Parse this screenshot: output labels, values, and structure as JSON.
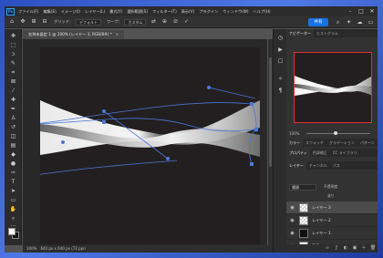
{
  "app": {
    "logo": "Ps"
  },
  "menu": [
    "ファイル(F)",
    "編集(E)",
    "イメージ(I)",
    "レイヤー(L)",
    "書式(Y)",
    "選択範囲(S)",
    "フィルター(T)",
    "表示(V)",
    "プラグイン",
    "ウィンドウ(W)",
    "ヘルプ(H)"
  ],
  "window_controls": [
    "–",
    "□",
    "✕"
  ],
  "options": {
    "grid_label": "グリッド：",
    "grid_value": "デフォルト",
    "warp_label": "ワープ：",
    "warp_value": "カスタム",
    "share_label": "共有"
  },
  "document": {
    "tab_title": "名称未設定 1 @ 100% (レイヤー 3, RGB/8#) *",
    "close": "×"
  },
  "status": {
    "zoom": "100%",
    "size": "640 px x 640 px (72 ppi)"
  },
  "panels": {
    "tabs_top": [
      "ナビゲーター",
      "ヒストグラム"
    ],
    "zoom_pct": "100%",
    "zoom_fraction": 0.45,
    "tabs_color": [
      "カラー",
      "スウォッチ",
      "グラデーション",
      "パターン"
    ],
    "tabs_props": [
      "プロパティ",
      "色調補正",
      "CC ライブラリ"
    ],
    "tabs_layers": [
      "レイヤー",
      "チャンネル",
      "パス"
    ],
    "layer_kind": "種類",
    "opacity_label": "不透明度",
    "fill_label": "塗り",
    "layers": [
      {
        "name": "レイヤー 3",
        "thumb": "checker",
        "selected": true
      },
      {
        "name": "レイヤー 2",
        "thumb": "checker",
        "selected": false
      },
      {
        "name": "レイヤー 1",
        "thumb": "black",
        "selected": false
      },
      {
        "name": "背景",
        "thumb": "white",
        "selected": false
      }
    ]
  },
  "colors": {
    "accent": "#1473e6",
    "navigator_frame": "#e03030",
    "warp_handles": "#4a78d8"
  }
}
